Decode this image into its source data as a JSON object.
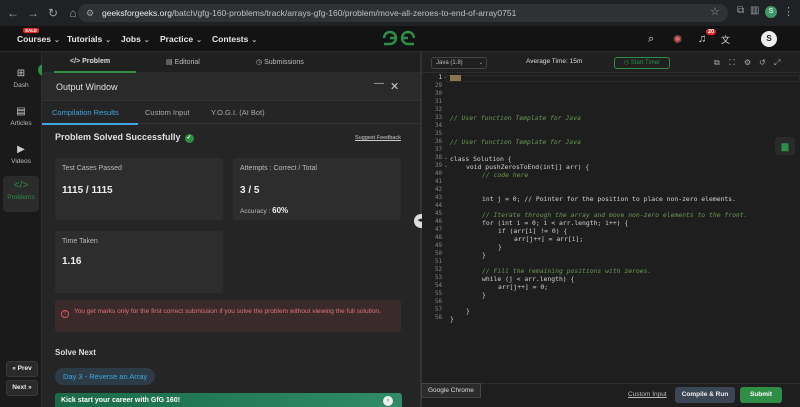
{
  "browser": {
    "url_domain": "geeksforgeeks.org",
    "url_path": "/batch/gfg-160-problems/track/arrays-gfg-160/problem/move-all-zeroes-to-end-of-array0751",
    "profile_initial": "S"
  },
  "site_nav": {
    "sale_badge": "SALE",
    "items": [
      "Courses",
      "Tutorials",
      "Jobs",
      "Practice",
      "Contests"
    ],
    "notification_count": "20",
    "user_initial": "S"
  },
  "rail": {
    "items": [
      "Dash",
      "Articles",
      "Videos",
      "Problems"
    ],
    "prev": "Prev",
    "next": "Next"
  },
  "problem_tabs": [
    "Problem",
    "Editorial",
    "Submissions"
  ],
  "output": {
    "title": "Output Window",
    "tabs": [
      "Compilation Results",
      "Custom Input",
      "Y.O.G.I. (AI Bot)"
    ],
    "status": "Problem Solved Successfully",
    "suggest": "Suggest Feedback",
    "test_label": "Test Cases Passed",
    "test_value": "1115 / 1115",
    "attempts_label": "Attempts : Correct / Total",
    "attempts_value": "3 / 5",
    "accuracy_label": "Accuracy :",
    "accuracy_value": "60%",
    "time_label": "Time Taken",
    "time_value": "1.16",
    "warning": "You get marks only for the first correct submission if you solve the problem without viewing the full solution.",
    "solve_next": "Solve Next",
    "next_day": "Day 3 - Reverse an Array",
    "kickstart": "Kick start your career with GfG 160!"
  },
  "editor": {
    "language": "Java (1.8)",
    "avg_time": "Average Time: 15m",
    "timer": "Start Timer",
    "custom_input": "Custom Input",
    "compile": "Compile & Run",
    "submit": "Submit",
    "tooltip": "Google Chrome",
    "line_numbers": [
      "1",
      "29",
      "30",
      "31",
      "32",
      "33",
      "34",
      "35",
      "36",
      "37",
      "38",
      "39",
      "40",
      "41",
      "42",
      "43",
      "44",
      "45",
      "46",
      "47",
      "48",
      "49",
      "50",
      "51",
      "52",
      "53",
      "54",
      "55",
      "56",
      "57",
      "58"
    ],
    "comment_1": "// User function Template for Java",
    "comment_2": "// User function Template for Java",
    "class_line": "class Solution {",
    "method_line": "void pushZerosToEnd(int[] arr) {",
    "code_here": "// code here",
    "int_j": "int j = 0; // Pointer for the position to place non-zero elements.",
    "iter_comment": "// Iterate through the array and move non-zero elements to the front.",
    "for_line": "for (int i = 0; i < arr.length; i++) {",
    "if_line": "if (arr[i] != 0) {",
    "assign_line": "arr[j++] = arr[i];",
    "fill_comment": "// Fill the remaining positions with zeroes.",
    "while_line": "while (j < arr.length) {",
    "zero_line": "arr[j++] = 0;"
  }
}
